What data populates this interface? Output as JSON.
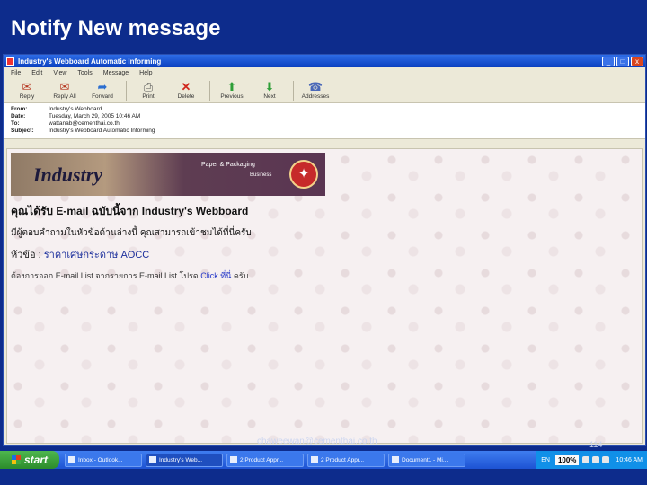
{
  "slide": {
    "title": "Notify New message",
    "footer_email": "chaweewan@cementhai.co.th",
    "page_number": "114"
  },
  "window": {
    "title": "Industry's Webboard Automatic Informing",
    "buttons": {
      "minimize": "_",
      "maximize": "□",
      "close": "x"
    }
  },
  "menu": [
    "File",
    "Edit",
    "View",
    "Tools",
    "Message",
    "Help"
  ],
  "toolbar": [
    {
      "label": "Reply",
      "icon": "reply-icon",
      "glyph": "✉"
    },
    {
      "label": "Reply All",
      "icon": "reply-all-icon",
      "glyph": "✉"
    },
    {
      "label": "Forward",
      "icon": "forward-icon",
      "glyph": "➦"
    },
    {
      "label": "Print",
      "icon": "print-icon",
      "glyph": "⎙"
    },
    {
      "label": "Delete",
      "icon": "delete-icon",
      "glyph": "✕"
    },
    {
      "label": "Previous",
      "icon": "previous-icon",
      "glyph": "⬆"
    },
    {
      "label": "Next",
      "icon": "next-icon",
      "glyph": "⬇"
    },
    {
      "label": "Addresses",
      "icon": "addresses-icon",
      "glyph": "☎"
    }
  ],
  "headers": {
    "from_key": "From:",
    "from": "Industry's Webboard",
    "date_key": "Date:",
    "date": "Tuesday, March 29, 2005 10:46 AM",
    "to_key": "To:",
    "to": "wattanab@cementhai.co.th",
    "subject_key": "Subject:",
    "subject": "Industry's Webboard Automatic Informing"
  },
  "email": {
    "banner_logo": "Industry",
    "banner_sub1": "Paper & Packaging",
    "banner_sub2": "Business",
    "banner_emblem": "✦",
    "line1": "คุณได้รับ E-mail ฉบับนี้จาก Industry's Webboard",
    "line2": "มีผู้ตอบคำถามในหัวข้อด้านล่างนี้ คุณสามารถเข้าชมได้ที่นี่ครับ",
    "line3_prefix": "หัวข้อ : ",
    "line3_subject": "ราคาเศษกระดาษ AOCC",
    "line4_prefix": "ต้องการออก E-mail List จากรายการ E-mail List โปรด ",
    "line4_link": "Click ที่นี่",
    "line4_suffix": " ครับ"
  },
  "taskbar": {
    "start": "start",
    "items": [
      "Inbox - Outlook...",
      "Industry's Web...",
      "2 Product Appr...",
      "2 Product Appr...",
      "Document1 - Mi..."
    ],
    "lang": "EN",
    "zoom": "100%",
    "clock": "10:46 AM"
  }
}
